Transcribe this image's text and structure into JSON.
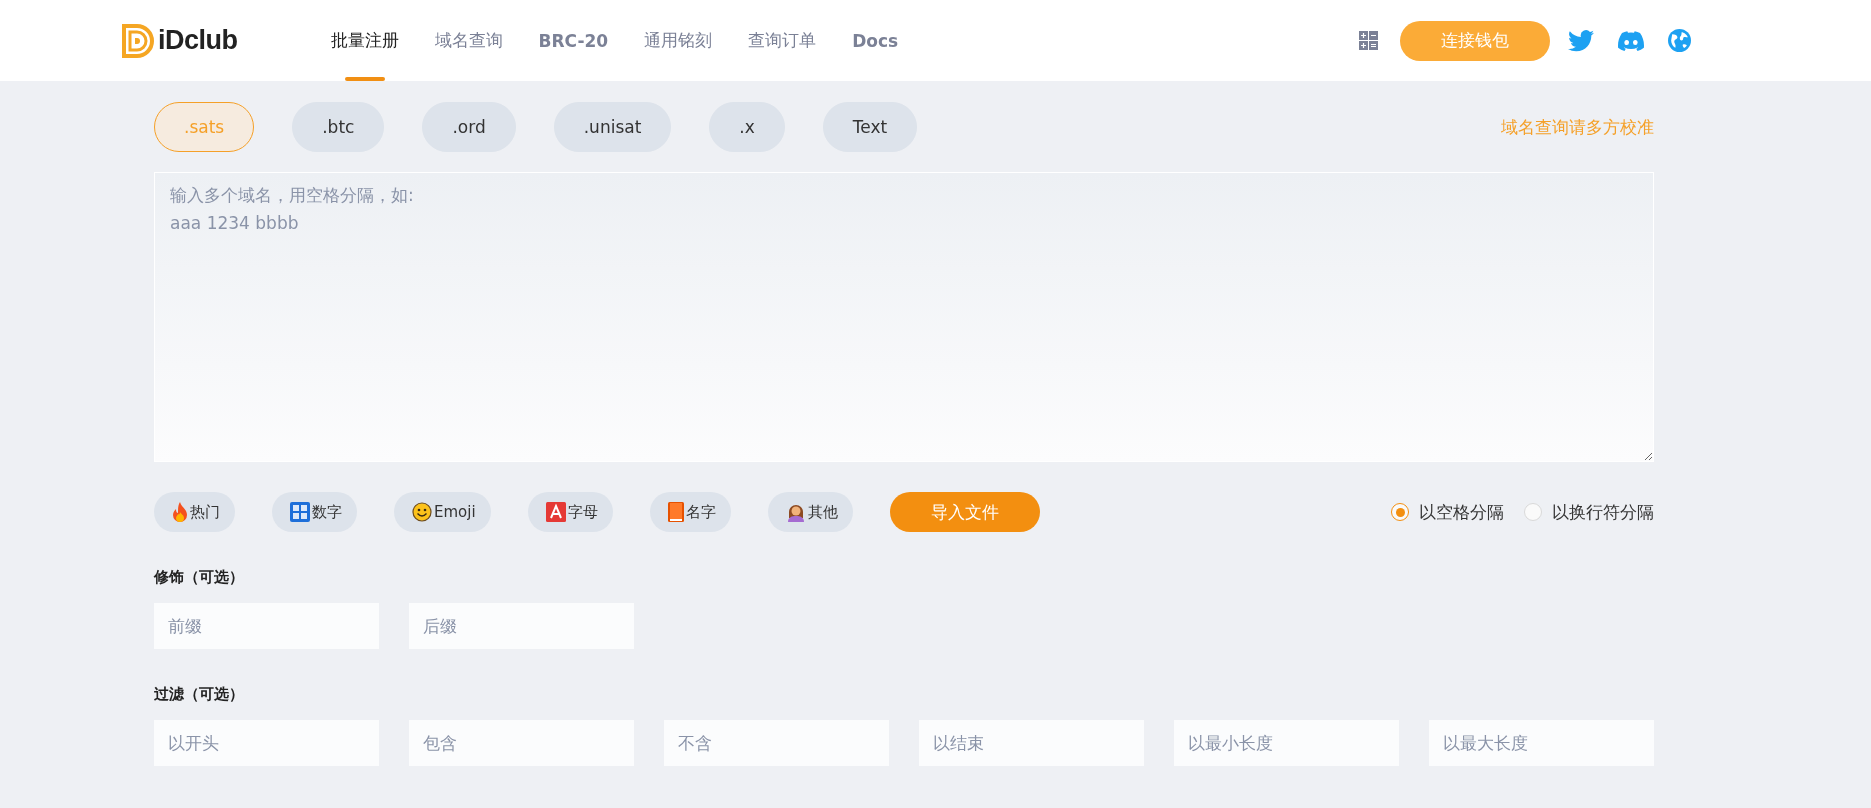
{
  "header": {
    "logo": "iDclub",
    "nav": [
      {
        "label": "批量注册",
        "selected": true
      },
      {
        "label": "域名查询",
        "selected": false
      },
      {
        "label": "BRC-20",
        "selected": false
      },
      {
        "label": "通用铭刻",
        "selected": false
      },
      {
        "label": "查询订单",
        "selected": false
      },
      {
        "label": "Docs",
        "selected": false
      }
    ],
    "connect_button": "连接钱包"
  },
  "tlds": [
    {
      "label": ".sats",
      "selected": true
    },
    {
      "label": ".btc",
      "selected": false
    },
    {
      "label": ".ord",
      "selected": false
    },
    {
      "label": ".unisat",
      "selected": false
    },
    {
      "label": ".x",
      "selected": false
    },
    {
      "label": "Text",
      "selected": false
    }
  ],
  "notice": "域名查询请多方校准",
  "domain_input": {
    "placeholder": "输入多个域名，用空格分隔，如:\naaa 1234 bbbb"
  },
  "categories": [
    {
      "kind": "fire",
      "label": "热门"
    },
    {
      "kind": "numbers",
      "label": "数字"
    },
    {
      "kind": "smiley",
      "label": "Emoji"
    },
    {
      "kind": "letter",
      "label": "字母"
    },
    {
      "kind": "book",
      "label": "名字"
    },
    {
      "kind": "person",
      "label": "其他"
    }
  ],
  "import_button": "导入文件",
  "separators": [
    {
      "label": "以空格分隔",
      "selected": true
    },
    {
      "label": "以换行符分隔",
      "selected": false
    }
  ],
  "decorate": {
    "title": "修饰（可选）",
    "fields": [
      {
        "placeholder": "前缀"
      },
      {
        "placeholder": "后缀"
      }
    ]
  },
  "filter": {
    "title": "过滤（可选）",
    "fields": [
      {
        "placeholder": "以开头"
      },
      {
        "placeholder": "包含"
      },
      {
        "placeholder": "不含"
      },
      {
        "placeholder": "以结束"
      },
      {
        "placeholder": "以最小长度"
      },
      {
        "placeholder": "以最大长度"
      }
    ]
  }
}
